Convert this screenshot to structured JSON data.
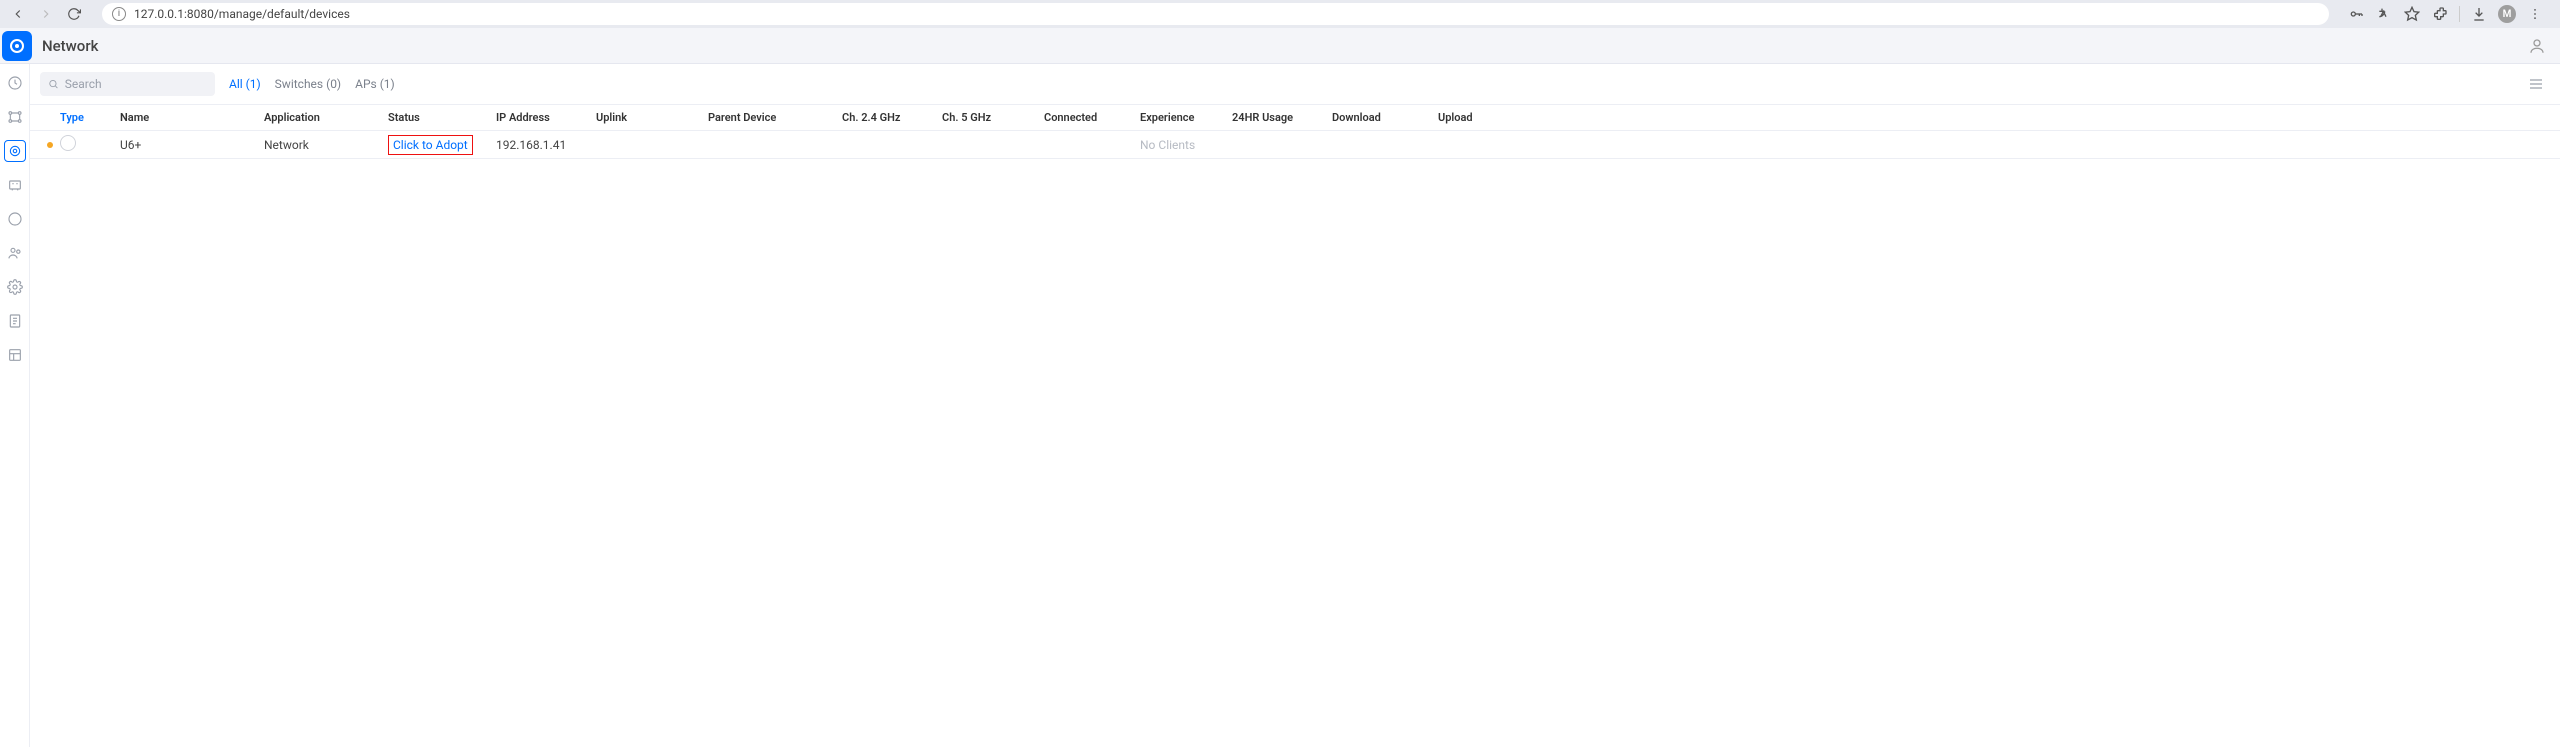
{
  "browser": {
    "url": "127.0.0.1:8080/manage/default/devices",
    "avatar_letter": "M"
  },
  "header": {
    "title": "Network"
  },
  "search": {
    "placeholder": "Search"
  },
  "filters": {
    "all": "All (1)",
    "switches": "Switches (0)",
    "aps": "APs (1)"
  },
  "table": {
    "headers": {
      "type": "Type",
      "name": "Name",
      "application": "Application",
      "status": "Status",
      "ip": "IP Address",
      "uplink": "Uplink",
      "parent": "Parent Device",
      "ch24": "Ch. 2.4 GHz",
      "ch5": "Ch. 5 GHz",
      "connected": "Connected",
      "experience": "Experience",
      "usage24": "24HR Usage",
      "download": "Download",
      "upload": "Upload"
    },
    "row": {
      "name": "U6+",
      "application": "Network",
      "status_action": "Click to Adopt",
      "ip": "192.168.1.41",
      "experience": "No Clients"
    }
  }
}
